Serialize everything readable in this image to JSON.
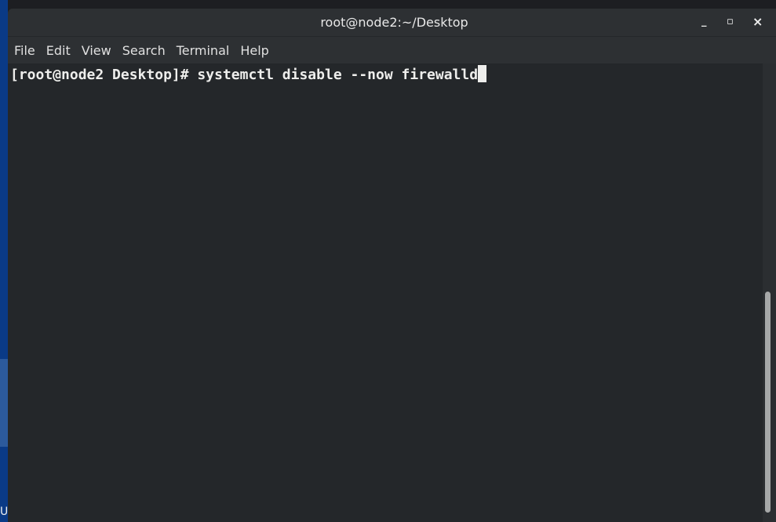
{
  "window": {
    "title": "root@node2:~/Desktop",
    "minimize": "_",
    "maximize": "▫",
    "close": "×"
  },
  "menu": [
    "File",
    "Edit",
    "View",
    "Search",
    "Terminal",
    "Help"
  ],
  "terminal": {
    "prompt": "[root@node2 Desktop]# ",
    "command": "systemctl disable --now firewalld"
  },
  "desktop": {
    "label": "Ur"
  }
}
